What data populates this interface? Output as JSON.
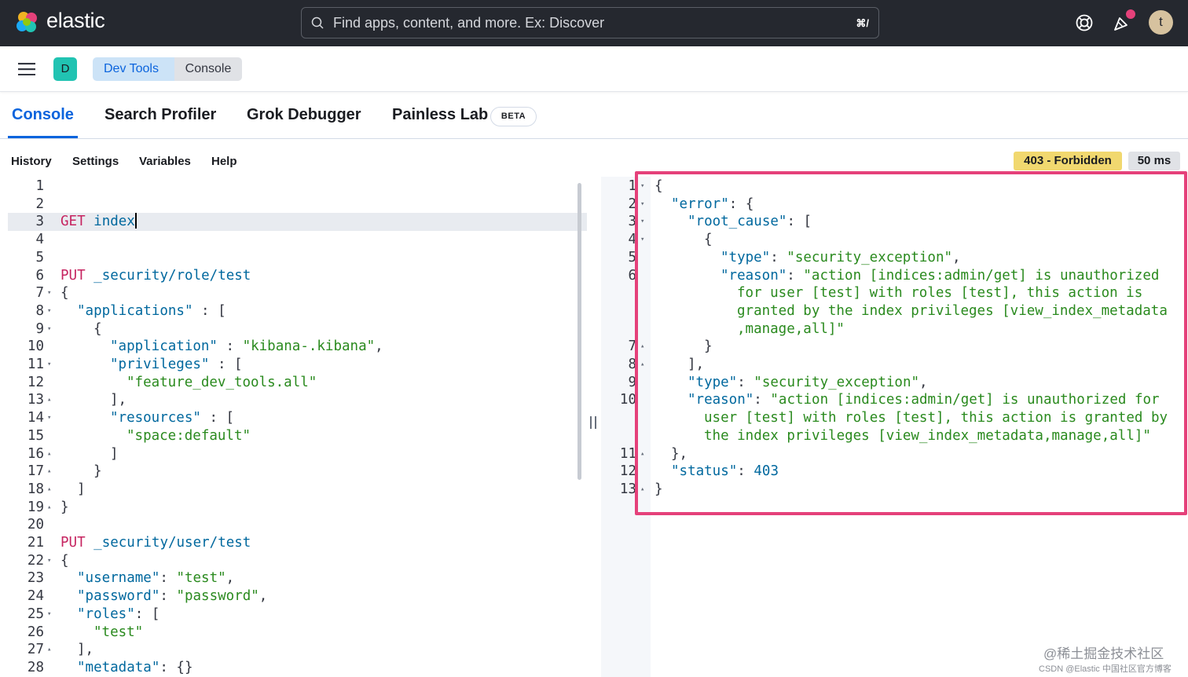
{
  "header": {
    "brand": "elastic",
    "search_placeholder": "Find apps, content, and more. Ex: Discover",
    "search_shortcut": "⌘/",
    "avatar_initial": "t"
  },
  "breadcrumbs": {
    "space_initial": "D",
    "items": [
      "Dev Tools",
      "Console"
    ]
  },
  "tabs": [
    {
      "label": "Console",
      "active": true
    },
    {
      "label": "Search Profiler"
    },
    {
      "label": "Grok Debugger"
    },
    {
      "label": "Painless Lab",
      "badge": "BETA"
    }
  ],
  "submenu": [
    "History",
    "Settings",
    "Variables",
    "Help"
  ],
  "response_status": "403 - Forbidden",
  "response_time": "50 ms",
  "request_editor": {
    "lines": [
      {
        "n": "1",
        "fold": "",
        "indent": 0,
        "text": ""
      },
      {
        "n": "2",
        "fold": "",
        "indent": 0,
        "text": ""
      },
      {
        "n": "3",
        "fold": "",
        "indent": 0,
        "method": "GET",
        "path": "index",
        "cursor": true
      },
      {
        "n": "4",
        "fold": "",
        "indent": 0,
        "text": ""
      },
      {
        "n": "5",
        "fold": "",
        "indent": 0,
        "text": ""
      },
      {
        "n": "6",
        "fold": "",
        "indent": 0,
        "method": "PUT",
        "path": "_security/role/test"
      },
      {
        "n": "7",
        "fold": "▾",
        "indent": 0,
        "text": "{"
      },
      {
        "n": "8",
        "fold": "▾",
        "indent": 1,
        "key": "\"applications\"",
        "rest": " : ["
      },
      {
        "n": "9",
        "fold": "▾",
        "indent": 2,
        "text": "{"
      },
      {
        "n": "10",
        "fold": "",
        "indent": 3,
        "key": "\"application\"",
        "rest": " : ",
        "str": "\"kibana-.kibana\"",
        "tail": ","
      },
      {
        "n": "11",
        "fold": "▾",
        "indent": 3,
        "key": "\"privileges\"",
        "rest": " : ["
      },
      {
        "n": "12",
        "fold": "",
        "indent": 4,
        "str": "\"feature_dev_tools.all\""
      },
      {
        "n": "13",
        "fold": "▴",
        "indent": 3,
        "text": "],"
      },
      {
        "n": "14",
        "fold": "▾",
        "indent": 3,
        "key": "\"resources\"",
        "rest": " : ["
      },
      {
        "n": "15",
        "fold": "",
        "indent": 4,
        "str": "\"space:default\""
      },
      {
        "n": "16",
        "fold": "▴",
        "indent": 3,
        "text": "]"
      },
      {
        "n": "17",
        "fold": "▴",
        "indent": 2,
        "text": "}"
      },
      {
        "n": "18",
        "fold": "▴",
        "indent": 1,
        "text": "]"
      },
      {
        "n": "19",
        "fold": "▴",
        "indent": 0,
        "text": "}"
      },
      {
        "n": "20",
        "fold": "",
        "indent": 0,
        "text": ""
      },
      {
        "n": "21",
        "fold": "",
        "indent": 0,
        "method": "PUT",
        "path": "_security/user/test"
      },
      {
        "n": "22",
        "fold": "▾",
        "indent": 0,
        "text": "{"
      },
      {
        "n": "23",
        "fold": "",
        "indent": 1,
        "key": "\"username\"",
        "rest": ": ",
        "str": "\"test\"",
        "tail": ","
      },
      {
        "n": "24",
        "fold": "",
        "indent": 1,
        "key": "\"password\"",
        "rest": ": ",
        "str": "\"password\"",
        "tail": ","
      },
      {
        "n": "25",
        "fold": "▾",
        "indent": 1,
        "key": "\"roles\"",
        "rest": ": ["
      },
      {
        "n": "26",
        "fold": "",
        "indent": 2,
        "str": "\"test\""
      },
      {
        "n": "27",
        "fold": "▴",
        "indent": 1,
        "text": "],"
      },
      {
        "n": "28",
        "fold": "",
        "indent": 1,
        "key": "\"metadata\"",
        "rest": ": {}"
      }
    ]
  },
  "response_editor": {
    "lines": [
      {
        "n": "1",
        "fold": "▾",
        "indent": 0,
        "text": "{"
      },
      {
        "n": "2",
        "fold": "▾",
        "indent": 1,
        "key": "\"error\"",
        "rest": ": {"
      },
      {
        "n": "3",
        "fold": "▾",
        "indent": 2,
        "key": "\"root_cause\"",
        "rest": ": ["
      },
      {
        "n": "4",
        "fold": "▾",
        "indent": 3,
        "text": "{"
      },
      {
        "n": "5",
        "fold": "",
        "indent": 4,
        "key": "\"type\"",
        "rest": ": ",
        "str": "\"security_exception\"",
        "tail": ","
      },
      {
        "n": "6",
        "fold": "",
        "indent": 4,
        "key": "\"reason\"",
        "rest": ": ",
        "str": "\"action [indices:admin/get] is unauthorized"
      },
      {
        "n": "",
        "fold": "",
        "indent": 5,
        "str": "for user [test] with roles [test], this action is"
      },
      {
        "n": "",
        "fold": "",
        "indent": 5,
        "str": "granted by the index privileges [view_index_metadata"
      },
      {
        "n": "",
        "fold": "",
        "indent": 5,
        "str": ",manage,all]\""
      },
      {
        "n": "7",
        "fold": "▴",
        "indent": 3,
        "text": "}"
      },
      {
        "n": "8",
        "fold": "▴",
        "indent": 2,
        "text": "],"
      },
      {
        "n": "9",
        "fold": "",
        "indent": 2,
        "key": "\"type\"",
        "rest": ": ",
        "str": "\"security_exception\"",
        "tail": ","
      },
      {
        "n": "10",
        "fold": "",
        "indent": 2,
        "key": "\"reason\"",
        "rest": ": ",
        "str": "\"action [indices:admin/get] is unauthorized for"
      },
      {
        "n": "",
        "fold": "",
        "indent": 3,
        "str": "user [test] with roles [test], this action is granted by"
      },
      {
        "n": "",
        "fold": "",
        "indent": 3,
        "str": "the index privileges [view_index_metadata,manage,all]\""
      },
      {
        "n": "11",
        "fold": "▴",
        "indent": 1,
        "text": "},"
      },
      {
        "n": "12",
        "fold": "",
        "indent": 1,
        "key": "\"status\"",
        "rest": ": ",
        "num": "403"
      },
      {
        "n": "13",
        "fold": "▴",
        "indent": 0,
        "text": "}"
      }
    ]
  },
  "watermark": "@稀土掘金技术社区",
  "watermark_sub": "CSDN @Elastic 中国社区官方博客",
  "colors": {
    "accent": "#0b64dd",
    "header_bg": "#25282f",
    "highlight_border": "#e5417a",
    "status_warning": "#f1d86f"
  }
}
